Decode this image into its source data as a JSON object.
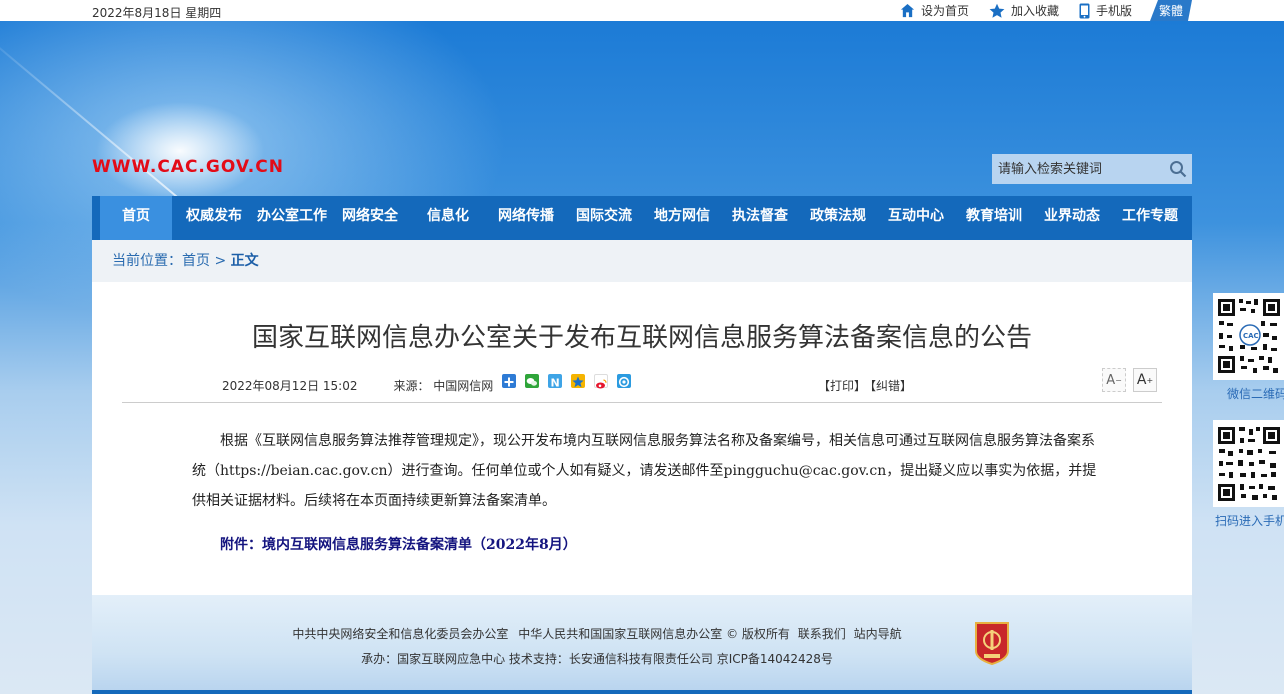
{
  "top": {
    "date": "2022年8月18日 星期四",
    "links": [
      "设为首页",
      "加入收藏",
      "手机版"
    ],
    "traditional": "繁體"
  },
  "logo_url": "WWW.CAC.GOV.CN",
  "search": {
    "placeholder": "请输入检索关键词"
  },
  "nav": [
    "首页",
    "权威发布",
    "办公室工作",
    "网络安全",
    "信息化",
    "网络传播",
    "国际交流",
    "地方网信",
    "执法督查",
    "政策法规",
    "互动中心",
    "教育培训",
    "业界动态",
    "工作专题"
  ],
  "breadcrumb": {
    "prefix": "当前位置：",
    "home": "首页",
    "sep": " > ",
    "current": "正文"
  },
  "article": {
    "title": "国家互联网信息办公室关于发布互联网信息服务算法备案信息的公告",
    "date": "2022年08月12日 15:02",
    "source": "来源： 中国网信网",
    "print": "【打印】",
    "error": "【纠错】",
    "font_small": "A",
    "font_big": "A",
    "paragraph": "根据《互联网信息服务算法推荐管理规定》，现公开发布境内互联网信息服务算法名称及备案编号，相关信息可通过互联网信息服务算法备案系统（https://beian.cac.gov.cn）进行查询。任何单位或个人如有疑义，请发送邮件至pingguchu@cac.gov.cn，提出疑义应以事实为依据，并提供相关证据材料。后续将在本页面持续更新算法备案清单。",
    "attachment": "附件：境内互联网信息服务算法备案清单（2022年8月）"
  },
  "footer": {
    "org1": "中共中央网络安全和信息化委员会办公室",
    "org2": "中华人民共和国国家互联网信息办公室",
    "copyright": "© 版权所有",
    "contact": "联系我们",
    "sitemap": "站内导航",
    "line2": "承办：国家互联网应急中心  技术支持：长安通信科技有限责任公司  京ICP备14042428号"
  },
  "side": {
    "qr1_label": "微信二维码",
    "qr2_label": "扫码进入手机"
  },
  "colors": {
    "nav": "#1469bb",
    "logo_red": "#e30b17",
    "link_blue": "#2b6cb0"
  }
}
